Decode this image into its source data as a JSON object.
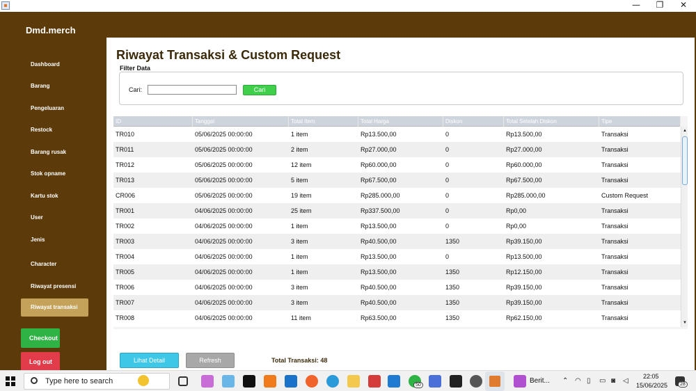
{
  "window": {
    "minimize_glyph": "—",
    "maximize_glyph": "❐",
    "close_glyph": "✕"
  },
  "sidebar": {
    "brand": "Dmd.merch",
    "items": [
      {
        "label": "Dashboard"
      },
      {
        "label": "Barang"
      },
      {
        "label": "Pengeluaran"
      },
      {
        "label": "Restock"
      },
      {
        "label": "Barang rusak"
      },
      {
        "label": "Stok opname"
      },
      {
        "label": "Kartu stok"
      },
      {
        "label": "User"
      },
      {
        "label": "Jenis"
      },
      {
        "label": "Character"
      },
      {
        "label": "Riwayat presensi"
      }
    ],
    "active_item": "Riwayat transaksi",
    "checkout_label": "Checkout",
    "logout_label": "Log out",
    "colors": {
      "sidebar_bg": "#5c3a0a",
      "active_bg": "#c5a25a",
      "checkout_bg": "#2fb344",
      "logout_bg": "#e23b4a"
    }
  },
  "main": {
    "title": "Riwayat Transaksi & Custom Request",
    "filter": {
      "label": "Filter Data",
      "search_label": "Cari:",
      "search_value": "",
      "search_button": "Cari"
    },
    "table": {
      "columns": [
        "ID",
        "Tanggal",
        "Total Item",
        "Total Harga",
        "Diskon",
        "Total Setelah Diskon",
        "Tipe"
      ],
      "rows": [
        [
          "TR010",
          "05/06/2025 00:00:00",
          "1 item",
          "Rp13.500,00",
          "0",
          "Rp13.500,00",
          "Transaksi"
        ],
        [
          "TR011",
          "05/06/2025 00:00:00",
          "2 item",
          "Rp27.000,00",
          "0",
          "Rp27.000,00",
          "Transaksi"
        ],
        [
          "TR012",
          "05/06/2025 00:00:00",
          "12 item",
          "Rp60.000,00",
          "0",
          "Rp60.000,00",
          "Transaksi"
        ],
        [
          "TR013",
          "05/06/2025 00:00:00",
          "5 item",
          "Rp67.500,00",
          "0",
          "Rp67.500,00",
          "Transaksi"
        ],
        [
          "CR006",
          "05/06/2025 00:00:00",
          "19 item",
          "Rp285.000,00",
          "0",
          "Rp285.000,00",
          "Custom Request"
        ],
        [
          "TR001",
          "04/06/2025 00:00:00",
          "25 item",
          "Rp337.500,00",
          "0",
          "Rp0,00",
          "Transaksi"
        ],
        [
          "TR002",
          "04/06/2025 00:00:00",
          "1 item",
          "Rp13.500,00",
          "0",
          "Rp0,00",
          "Transaksi"
        ],
        [
          "TR003",
          "04/06/2025 00:00:00",
          "3 item",
          "Rp40.500,00",
          "1350",
          "Rp39.150,00",
          "Transaksi"
        ],
        [
          "TR004",
          "04/06/2025 00:00:00",
          "1 item",
          "Rp13.500,00",
          "0",
          "Rp13.500,00",
          "Transaksi"
        ],
        [
          "TR005",
          "04/06/2025 00:00:00",
          "1 item",
          "Rp13.500,00",
          "1350",
          "Rp12.150,00",
          "Transaksi"
        ],
        [
          "TR006",
          "04/06/2025 00:00:00",
          "3 item",
          "Rp40.500,00",
          "1350",
          "Rp39.150,00",
          "Transaksi"
        ],
        [
          "TR007",
          "04/06/2025 00:00:00",
          "3 item",
          "Rp40.500,00",
          "1350",
          "Rp39.150,00",
          "Transaksi"
        ],
        [
          "TR008",
          "04/06/2025 00:00:00",
          "11 item",
          "Rp63.500,00",
          "1350",
          "Rp62.150,00",
          "Transaksi"
        ]
      ]
    },
    "detail_button": "Lihat Detail",
    "refresh_button": "Refresh",
    "total_label": "Total Transaksi: 48",
    "colors": {
      "title": "#3b2a0a",
      "search_button": "#3fcf4a",
      "detail_button": "#3ec7e6",
      "refresh_button": "#a8a8a8"
    }
  },
  "taskbar": {
    "search_placeholder": "Type here to search",
    "app_label": "Berit...",
    "whatsapp_badge": "50",
    "notification_badge": "28",
    "clock_time": "22:05",
    "clock_date": "15/06/2025"
  }
}
